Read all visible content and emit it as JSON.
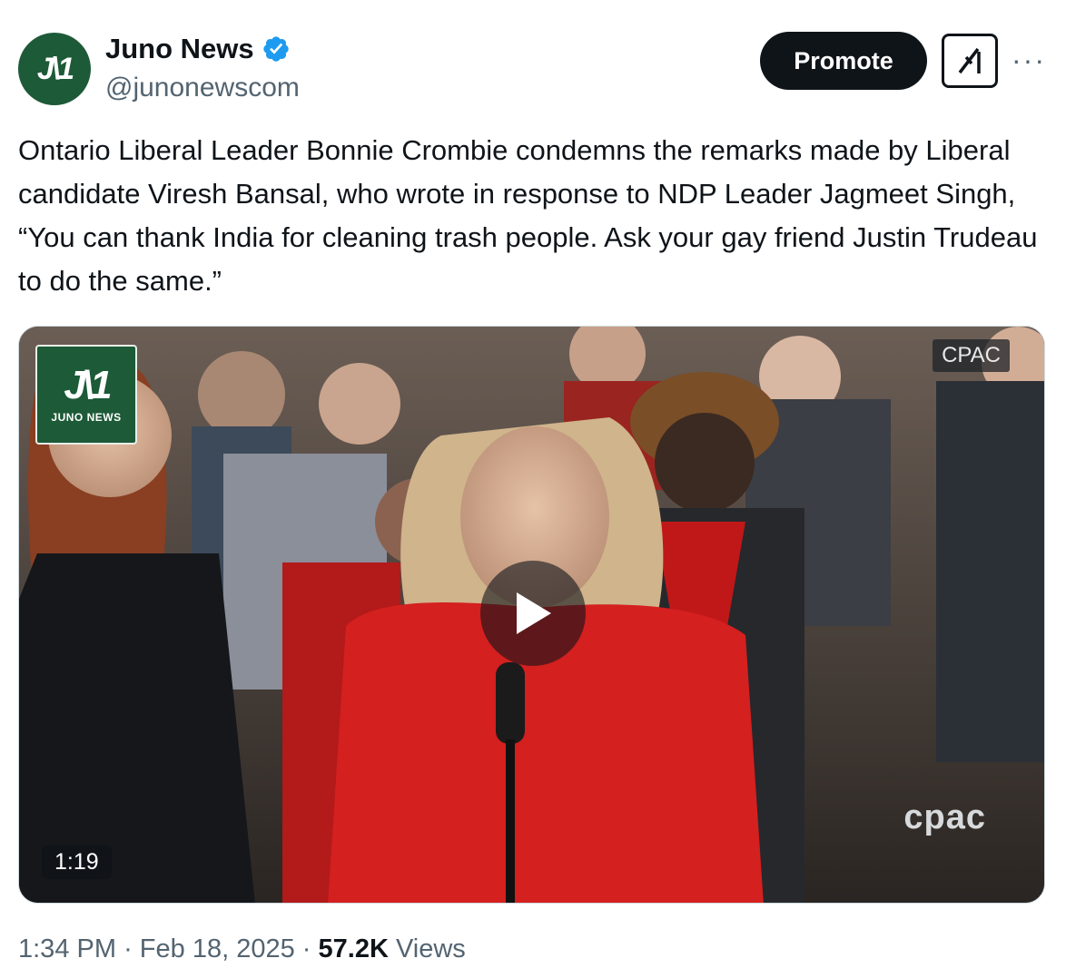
{
  "account": {
    "display_name": "Juno News",
    "handle": "@junonewscom",
    "avatar_text": "J\\1",
    "verified_icon": "verified-badge-icon"
  },
  "actions": {
    "promote_label": "Promote",
    "grok_icon": "grok-icon",
    "more_icon": "more-icon",
    "more_glyph": "···"
  },
  "tweet": {
    "text": "Ontario Liberal Leader Bonnie Crombie condemns the remarks made by Liberal candidate Viresh Bansal, who wrote in response to NDP Leader Jagmeet Singh, “You can thank India for cleaning trash people. Ask your gay friend Justin Trudeau to do the same.”"
  },
  "video": {
    "watermark_mark": "J\\1",
    "watermark_word": "JUNO NEWS",
    "channel_bug": "CPAC",
    "channel_logo": "cpac",
    "duration": "1:19",
    "play_icon": "play-icon"
  },
  "meta": {
    "time": "1:34 PM",
    "separator": "·",
    "date": "Feb 18, 2025",
    "views_count": "57.2K",
    "views_label": "Views"
  },
  "colors": {
    "brand_green": "#1d5a37",
    "verified_blue": "#1d9bf0",
    "text_primary": "#0f1419",
    "text_secondary": "#536471"
  }
}
